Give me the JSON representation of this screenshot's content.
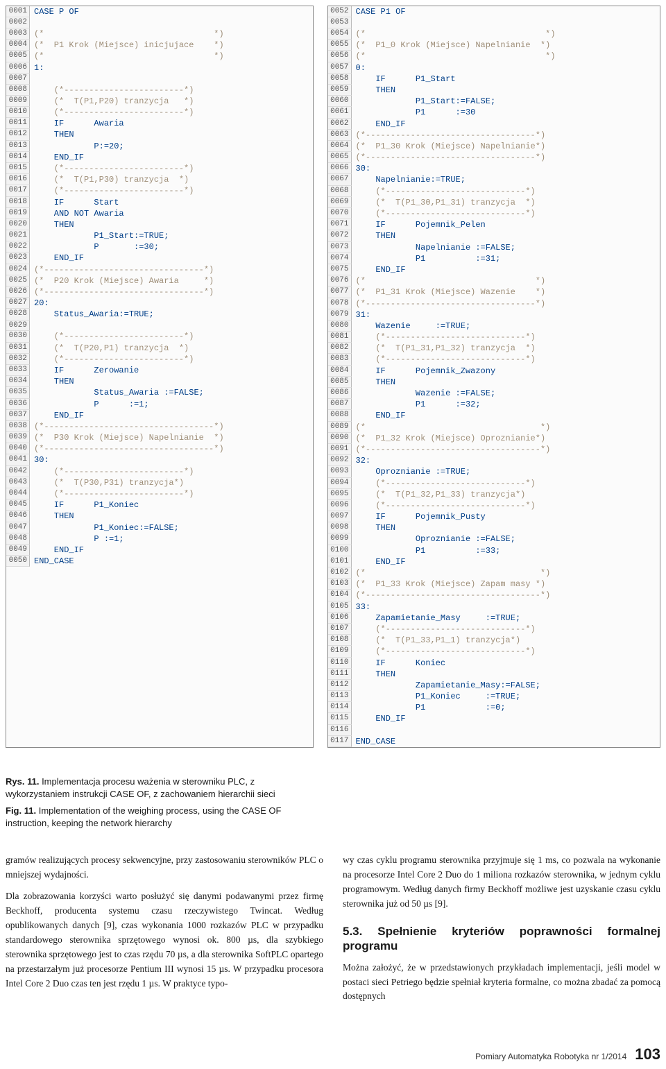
{
  "code_left": [
    {
      "n": "0001",
      "t": "CASE P OF",
      "c": "kw"
    },
    {
      "n": "0002",
      "t": "",
      "c": "kw"
    },
    {
      "n": "0003",
      "t": "(*                                  *)",
      "c": "comment"
    },
    {
      "n": "0004",
      "t": "(*  P1 Krok (Miejsce) inicjujace    *)",
      "c": "comment"
    },
    {
      "n": "0005",
      "t": "(*                                  *)",
      "c": "comment"
    },
    {
      "n": "0006",
      "t": "1:",
      "c": "kw"
    },
    {
      "n": "0007",
      "t": "",
      "c": "kw"
    },
    {
      "n": "0008",
      "t": "    (*------------------------*)",
      "c": "comment"
    },
    {
      "n": "0009",
      "t": "    (*  T(P1,P20) tranzycja   *)",
      "c": "comment"
    },
    {
      "n": "0010",
      "t": "    (*------------------------*)",
      "c": "comment"
    },
    {
      "n": "0011",
      "t": "    IF      Awaria",
      "c": "kw"
    },
    {
      "n": "0012",
      "t": "    THEN",
      "c": "kw"
    },
    {
      "n": "0013",
      "t": "            P:=20;",
      "c": "kw"
    },
    {
      "n": "0014",
      "t": "    END_IF",
      "c": "kw"
    },
    {
      "n": "0015",
      "t": "    (*------------------------*)",
      "c": "comment"
    },
    {
      "n": "0016",
      "t": "    (*  T(P1,P30) tranzycja  *)",
      "c": "comment"
    },
    {
      "n": "0017",
      "t": "    (*------------------------*)",
      "c": "comment"
    },
    {
      "n": "0018",
      "t": "    IF      Start",
      "c": "kw"
    },
    {
      "n": "0019",
      "t": "    AND NOT Awaria",
      "c": "kw"
    },
    {
      "n": "0020",
      "t": "    THEN",
      "c": "kw"
    },
    {
      "n": "0021",
      "t": "            P1_Start:=TRUE;",
      "c": "kw"
    },
    {
      "n": "0022",
      "t": "            P       :=30;",
      "c": "kw"
    },
    {
      "n": "0023",
      "t": "    END_IF",
      "c": "kw"
    },
    {
      "n": "0024",
      "t": "(*--------------------------------*)",
      "c": "comment"
    },
    {
      "n": "0025",
      "t": "(*  P20 Krok (Miejsce) Awaria     *)",
      "c": "comment"
    },
    {
      "n": "0026",
      "t": "(*--------------------------------*)",
      "c": "comment"
    },
    {
      "n": "0027",
      "t": "20:",
      "c": "kw"
    },
    {
      "n": "0028",
      "t": "    Status_Awaria:=TRUE;",
      "c": "kw"
    },
    {
      "n": "0029",
      "t": "",
      "c": "kw"
    },
    {
      "n": "0030",
      "t": "    (*------------------------*)",
      "c": "comment"
    },
    {
      "n": "0031",
      "t": "    (*  T(P20,P1) tranzycja  *)",
      "c": "comment"
    },
    {
      "n": "0032",
      "t": "    (*------------------------*)",
      "c": "comment"
    },
    {
      "n": "0033",
      "t": "    IF      Zerowanie",
      "c": "kw"
    },
    {
      "n": "0034",
      "t": "    THEN",
      "c": "kw"
    },
    {
      "n": "0035",
      "t": "            Status_Awaria :=FALSE;",
      "c": "kw"
    },
    {
      "n": "0036",
      "t": "            P      :=1;",
      "c": "kw"
    },
    {
      "n": "0037",
      "t": "    END_IF",
      "c": "kw"
    },
    {
      "n": "0038",
      "t": "(*----------------------------------*)",
      "c": "comment"
    },
    {
      "n": "0039",
      "t": "(*  P30 Krok (Miejsce) Napelnianie  *)",
      "c": "comment"
    },
    {
      "n": "0040",
      "t": "(*----------------------------------*)",
      "c": "comment"
    },
    {
      "n": "0041",
      "t": "30:",
      "c": "kw"
    },
    {
      "n": "0042",
      "t": "    (*------------------------*)",
      "c": "comment"
    },
    {
      "n": "0043",
      "t": "    (*  T(P30,P31) tranzycja*)",
      "c": "comment"
    },
    {
      "n": "0044",
      "t": "    (*------------------------*)",
      "c": "comment"
    },
    {
      "n": "0045",
      "t": "    IF      P1_Koniec",
      "c": "kw"
    },
    {
      "n": "0046",
      "t": "    THEN",
      "c": "kw"
    },
    {
      "n": "0047",
      "t": "            P1_Koniec:=FALSE;",
      "c": "kw"
    },
    {
      "n": "0048",
      "t": "            P :=1;",
      "c": "kw"
    },
    {
      "n": "0049",
      "t": "    END_IF",
      "c": "kw"
    },
    {
      "n": "0050",
      "t": "END_CASE",
      "c": "kw"
    }
  ],
  "code_right": [
    {
      "n": "0052",
      "t": "CASE P1 OF",
      "c": "kw"
    },
    {
      "n": "0053",
      "t": "",
      "c": "kw"
    },
    {
      "n": "0054",
      "t": "(*                                    *)",
      "c": "comment"
    },
    {
      "n": "0055",
      "t": "(*  P1_0 Krok (Miejsce) Napelnianie  *)",
      "c": "comment"
    },
    {
      "n": "0056",
      "t": "(*                                    *)",
      "c": "comment"
    },
    {
      "n": "0057",
      "t": "0:",
      "c": "kw"
    },
    {
      "n": "0058",
      "t": "    IF      P1_Start",
      "c": "kw"
    },
    {
      "n": "0059",
      "t": "    THEN",
      "c": "kw"
    },
    {
      "n": "0060",
      "t": "            P1_Start:=FALSE;",
      "c": "kw"
    },
    {
      "n": "0061",
      "t": "            P1      :=30",
      "c": "kw"
    },
    {
      "n": "0062",
      "t": "    END_IF",
      "c": "kw"
    },
    {
      "n": "0063",
      "t": "(*----------------------------------*)",
      "c": "comment"
    },
    {
      "n": "0064",
      "t": "(*  P1_30 Krok (Miejsce) Napelnianie*)",
      "c": "comment"
    },
    {
      "n": "0065",
      "t": "(*----------------------------------*)",
      "c": "comment"
    },
    {
      "n": "0066",
      "t": "30:",
      "c": "kw"
    },
    {
      "n": "0067",
      "t": "    Napelnianie:=TRUE;",
      "c": "kw"
    },
    {
      "n": "0068",
      "t": "    (*----------------------------*)",
      "c": "comment"
    },
    {
      "n": "0069",
      "t": "    (*  T(P1_30,P1_31) tranzycja  *)",
      "c": "comment"
    },
    {
      "n": "0070",
      "t": "    (*----------------------------*)",
      "c": "comment"
    },
    {
      "n": "0071",
      "t": "    IF      Pojemnik_Pelen",
      "c": "kw"
    },
    {
      "n": "0072",
      "t": "    THEN",
      "c": "kw"
    },
    {
      "n": "0073",
      "t": "            Napelnianie :=FALSE;",
      "c": "kw"
    },
    {
      "n": "0074",
      "t": "            P1          :=31;",
      "c": "kw"
    },
    {
      "n": "0075",
      "t": "    END_IF",
      "c": "kw"
    },
    {
      "n": "0076",
      "t": "(*                                  *)",
      "c": "comment"
    },
    {
      "n": "0077",
      "t": "(*  P1_31 Krok (Miejsce) Wazenie    *)",
      "c": "comment"
    },
    {
      "n": "0078",
      "t": "(*----------------------------------*)",
      "c": "comment"
    },
    {
      "n": "0079",
      "t": "31:",
      "c": "kw"
    },
    {
      "n": "0080",
      "t": "    Wazenie     :=TRUE;",
      "c": "kw"
    },
    {
      "n": "0081",
      "t": "    (*----------------------------*)",
      "c": "comment"
    },
    {
      "n": "0082",
      "t": "    (*  T(P1_31,P1_32) tranzycja  *)",
      "c": "comment"
    },
    {
      "n": "0083",
      "t": "    (*----------------------------*)",
      "c": "comment"
    },
    {
      "n": "0084",
      "t": "    IF      Pojemnik_Zwazony",
      "c": "kw"
    },
    {
      "n": "0085",
      "t": "    THEN",
      "c": "kw"
    },
    {
      "n": "0086",
      "t": "            Wazenie :=FALSE;",
      "c": "kw"
    },
    {
      "n": "0087",
      "t": "            P1      :=32;",
      "c": "kw"
    },
    {
      "n": "0088",
      "t": "    END_IF",
      "c": "kw"
    },
    {
      "n": "0089",
      "t": "(*                                   *)",
      "c": "comment"
    },
    {
      "n": "0090",
      "t": "(*  P1_32 Krok (Miejsce) Oproznianie*)",
      "c": "comment"
    },
    {
      "n": "0091",
      "t": "(*-----------------------------------*)",
      "c": "comment"
    },
    {
      "n": "0092",
      "t": "32:",
      "c": "kw"
    },
    {
      "n": "0093",
      "t": "    Oproznianie :=TRUE;",
      "c": "kw"
    },
    {
      "n": "0094",
      "t": "    (*----------------------------*)",
      "c": "comment"
    },
    {
      "n": "0095",
      "t": "    (*  T(P1_32,P1_33) tranzycja*)",
      "c": "comment"
    },
    {
      "n": "0096",
      "t": "    (*----------------------------*)",
      "c": "comment"
    },
    {
      "n": "0097",
      "t": "    IF      Pojemnik_Pusty",
      "c": "kw"
    },
    {
      "n": "0098",
      "t": "    THEN",
      "c": "kw"
    },
    {
      "n": "0099",
      "t": "            Oproznianie :=FALSE;",
      "c": "kw"
    },
    {
      "n": "0100",
      "t": "            P1          :=33;",
      "c": "kw"
    },
    {
      "n": "0101",
      "t": "    END_IF",
      "c": "kw"
    },
    {
      "n": "0102",
      "t": "(*                                   *)",
      "c": "comment"
    },
    {
      "n": "0103",
      "t": "(*  P1_33 Krok (Miejsce) Zapam masy *)",
      "c": "comment"
    },
    {
      "n": "0104",
      "t": "(*-----------------------------------*)",
      "c": "comment"
    },
    {
      "n": "0105",
      "t": "33:",
      "c": "kw"
    },
    {
      "n": "0106",
      "t": "    Zapamietanie_Masy     :=TRUE;",
      "c": "kw"
    },
    {
      "n": "0107",
      "t": "    (*----------------------------*)",
      "c": "comment"
    },
    {
      "n": "0108",
      "t": "    (*  T(P1_33,P1_1) tranzycja*)",
      "c": "comment"
    },
    {
      "n": "0109",
      "t": "    (*----------------------------*)",
      "c": "comment"
    },
    {
      "n": "0110",
      "t": "    IF      Koniec",
      "c": "kw"
    },
    {
      "n": "0111",
      "t": "    THEN",
      "c": "kw"
    },
    {
      "n": "0112",
      "t": "            Zapamietanie_Masy:=FALSE;",
      "c": "kw"
    },
    {
      "n": "0113",
      "t": "            P1_Koniec     :=TRUE;",
      "c": "kw"
    },
    {
      "n": "0114",
      "t": "            P1            :=0;",
      "c": "kw"
    },
    {
      "n": "0115",
      "t": "    END_IF",
      "c": "kw"
    },
    {
      "n": "0116",
      "t": "",
      "c": "kw"
    },
    {
      "n": "0117",
      "t": "END_CASE",
      "c": "kw"
    }
  ],
  "caption": {
    "pl_label": "Rys. 11.",
    "pl_text": "Implementacja procesu ważenia w sterowniku PLC, z wykorzystaniem instrukcji CASE OF, z zachowaniem hierarchii sieci",
    "en_label": "Fig. 11.",
    "en_text": "Implementation of the weighing process, using the CASE OF instruction, keeping the network hierarchy"
  },
  "body": {
    "col1_p1": "gramów realizujących procesy sekwencyjne, przy zastosowaniu sterowników PLC o mniejszej wydajności.",
    "col1_p2": "Dla zobrazowania korzyści warto posłużyć się danymi podawanymi przez firmę Beckhoff, producenta systemu czasu rzeczywistego Twincat. Według opublikowanych danych [9], czas wykonania 1000 rozkazów PLC w przypadku standardowego sterownika sprzętowego wynosi ok. 800 µs, dla szybkiego sterownika sprzętowego jest to czas rzędu 70 µs, a dla sterownika SoftPLC opartego na przestarzałym już procesorze Pentium III wynosi 15 µs. W przypadku procesora Intel Core 2 Duo czas ten jest rzędu 1 µs. W praktyce typo-",
    "col2_p1": "wy czas cyklu programu sterownika przyjmuje się 1 ms, co pozwala na wykonanie na procesorze Intel Core 2 Duo do 1 miliona rozkazów sterownika, w jednym cyklu programowym. Według danych firmy Beckhoff możliwe jest uzyskanie czasu cyklu sterownika już od 50 µs [9].",
    "col2_h3": "5.3. Spełnienie kryteriów poprawności formalnej programu",
    "col2_p2": "Można założyć, że w przedstawionych przykładach implementacji, jeśli model w postaci sieci Petriego będzie spełniał kryteria formalne, co można zbadać za pomocą dostępnych"
  },
  "footer": {
    "journal": "Pomiary Automatyka Robotyka nr 1/2014",
    "page": "103"
  }
}
